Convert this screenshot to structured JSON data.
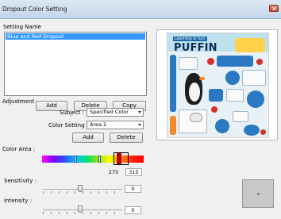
{
  "window": {
    "title": "Dropout Color Setting"
  },
  "settings": {
    "label": "Setting Name",
    "items": [
      "Blue and Red Dropout"
    ],
    "buttons": {
      "add": "Add",
      "delete": "Delete",
      "copy": "Copy"
    }
  },
  "adjustment": {
    "label": "Adjustment",
    "subject_label": "Subject :",
    "subject_value": "Specified Color",
    "color_setting_label": "Color Setting :",
    "color_setting_value": "Area 2",
    "buttons": {
      "add": "Add",
      "delete": "Delete"
    },
    "color_area_label": "Color Area :",
    "color_area_from": "275",
    "color_area_to": "315",
    "sensitivity_label": "Sensitivity :",
    "sensitivity_value": "0",
    "intensity_label": "Intensity :",
    "intensity_value": "0"
  },
  "preview": {
    "poster_subtitle": "Learning is fun!",
    "poster_title": "PUFFIN"
  },
  "colors": {
    "selection": "#3399ff",
    "spectrum_marker": "#c00000",
    "close": "#c4452b"
  }
}
